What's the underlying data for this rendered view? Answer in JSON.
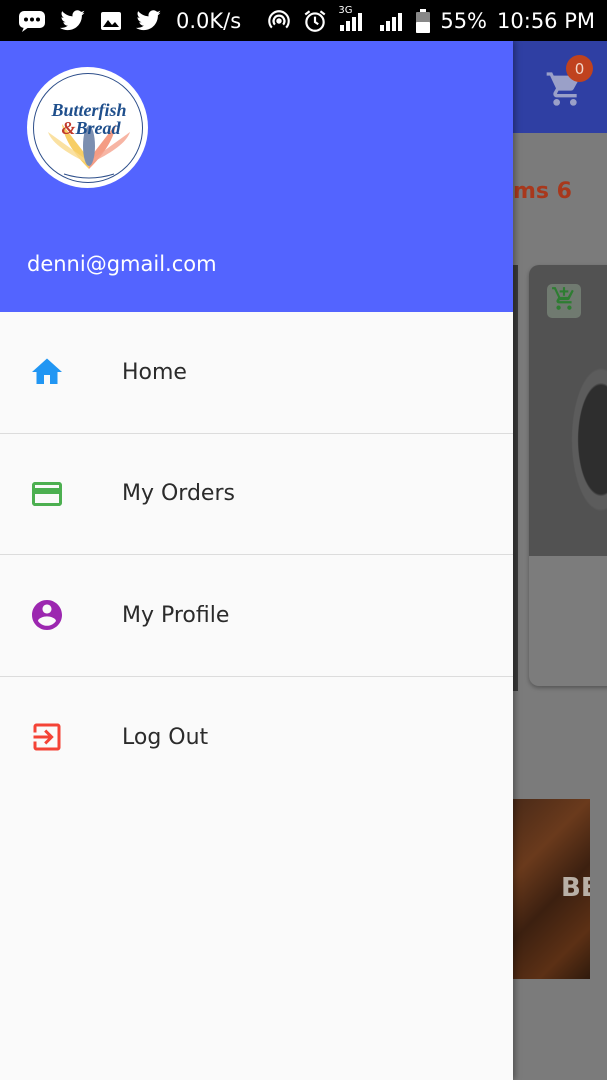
{
  "status_bar": {
    "network_speed": "0.0K/s",
    "network_type": "3G",
    "battery": "55%",
    "time": "10:56 PM",
    "icons": [
      "message-icon",
      "twitter-icon",
      "image-icon",
      "twitter-icon",
      "hotspot-icon",
      "alarm-icon",
      "signal-icon",
      "signal-icon",
      "battery-icon"
    ]
  },
  "background_app": {
    "cart_count": "0",
    "items_partial_text": "ms 6",
    "banner_partial_text": "BE",
    "colors": {
      "toolbar": "#3040a8",
      "items_text": "#a8381c",
      "badge": "#c0421e"
    }
  },
  "drawer": {
    "logo_text_line1": "Butterfish",
    "logo_text_line2": "&Bread",
    "user_email": "denni@gmail.com",
    "header_color": "#5364ff",
    "items": [
      {
        "label": "Home",
        "icon": "home-icon",
        "icon_color": "#2196f3"
      },
      {
        "label": "My Orders",
        "icon": "credit-card-icon",
        "icon_color": "#4caf50"
      },
      {
        "label": "My Profile",
        "icon": "account-circle-icon",
        "icon_color": "#9c27b0"
      },
      {
        "label": "Log Out",
        "icon": "logout-icon",
        "icon_color": "#f44336"
      }
    ]
  }
}
